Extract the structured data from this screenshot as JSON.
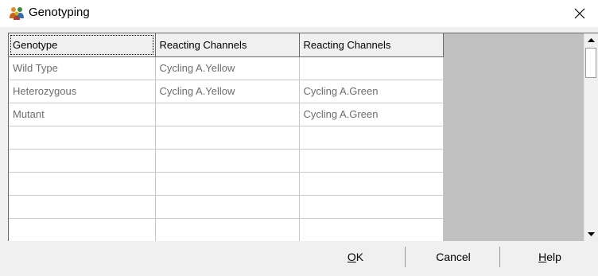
{
  "window": {
    "title": "Genotyping",
    "icon": "people-group-icon",
    "close_icon": "close-icon"
  },
  "grid": {
    "columns": [
      "Genotype",
      "Reacting Channels",
      "Reacting Channels"
    ],
    "rows": [
      [
        "Wild Type",
        "Cycling A.Yellow",
        ""
      ],
      [
        "Heterozygous",
        "Cycling A.Yellow",
        "Cycling A.Green"
      ],
      [
        "Mutant",
        "",
        "Cycling A.Green"
      ],
      [
        "",
        "",
        ""
      ],
      [
        "",
        "",
        ""
      ],
      [
        "",
        "",
        ""
      ],
      [
        "",
        "",
        ""
      ],
      [
        "",
        "",
        ""
      ]
    ]
  },
  "scrollbar": {
    "up_icon": "scroll-up-arrow-icon",
    "down_icon": "scroll-down-arrow-icon"
  },
  "buttons": {
    "ok": {
      "mnemonic": "O",
      "rest": "K"
    },
    "cancel": {
      "label": "Cancel"
    },
    "help": {
      "mnemonic": "H",
      "rest": "elp"
    }
  },
  "colors": {
    "grid_background": "#c0c0c0",
    "dialog_background": "#f0f0f0",
    "cell_text": "#6d6d6d"
  }
}
